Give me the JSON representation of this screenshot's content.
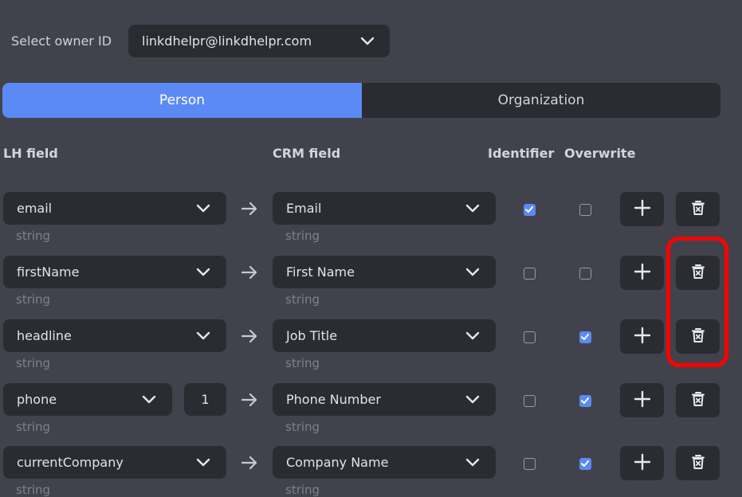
{
  "owner": {
    "label": "Select owner ID",
    "value": "linkdhelpr@linkdhelpr.com"
  },
  "tabs": {
    "person": "Person",
    "organization": "Organization",
    "active": "Person"
  },
  "headers": {
    "lh_field": "LH field",
    "crm_field": "CRM field",
    "identifier": "Identifier",
    "overwrite": "Overwrite"
  },
  "colors": {
    "accent": "#5b8af5",
    "highlight": "#ff0000",
    "background": "#41424b",
    "control": "#2b2c32"
  },
  "rows": [
    {
      "lh_field": "email",
      "lh_type": "string",
      "index": "",
      "crm_field": "Email",
      "crm_type": "string",
      "identifier": true,
      "overwrite": false
    },
    {
      "lh_field": "firstName",
      "lh_type": "string",
      "index": "",
      "crm_field": "First Name",
      "crm_type": "string",
      "identifier": false,
      "overwrite": false
    },
    {
      "lh_field": "headline",
      "lh_type": "string",
      "index": "",
      "crm_field": "Job Title",
      "crm_type": "string",
      "identifier": false,
      "overwrite": true
    },
    {
      "lh_field": "phone",
      "lh_type": "string",
      "index": "1",
      "crm_field": "Phone Number",
      "crm_type": "string",
      "identifier": false,
      "overwrite": true
    },
    {
      "lh_field": "currentCompany",
      "lh_type": "string",
      "index": "",
      "crm_field": "Company Name",
      "crm_type": "string",
      "identifier": false,
      "overwrite": true
    }
  ],
  "icons": {
    "dropdown": "chevron-down-icon",
    "arrow": "arrow-right-icon",
    "add": "plus-icon",
    "delete": "trash-icon",
    "check": "checkmark-icon"
  }
}
